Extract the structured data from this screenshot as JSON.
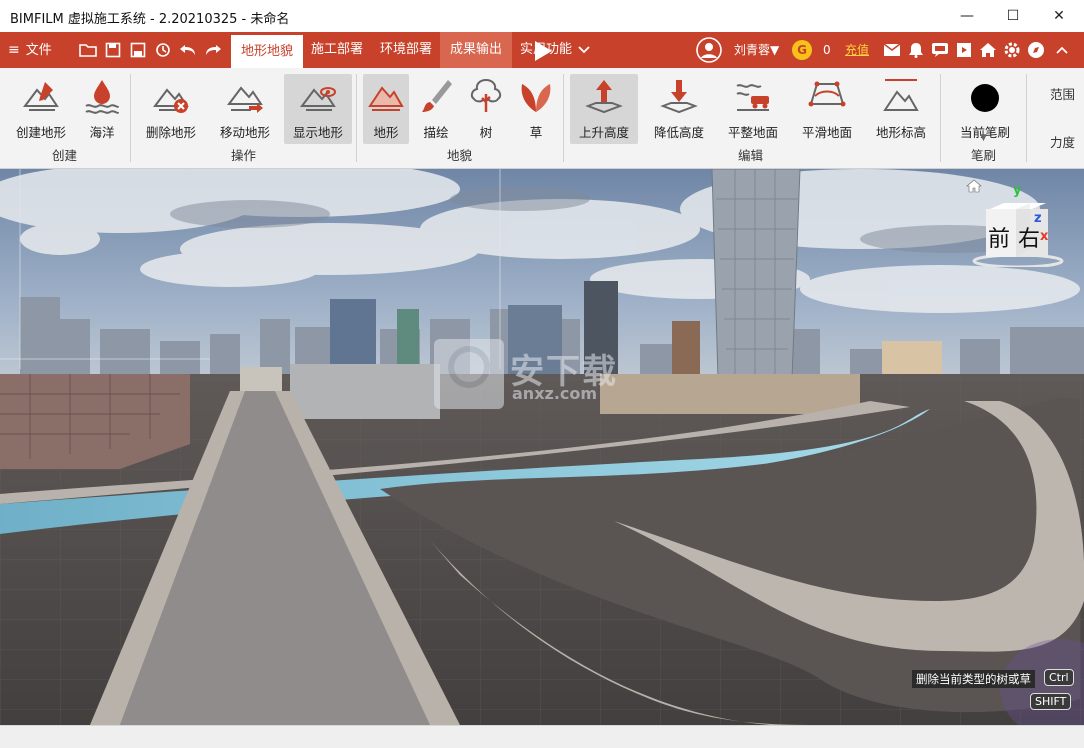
{
  "window": {
    "title": "BIMFILM 虚拟施工系统 - 2.20210325 - 未命名",
    "minimize": "—",
    "maximize": "☐",
    "close": "✕"
  },
  "menubar": {
    "file_label": "文件",
    "tabs": [
      {
        "label": "地形地貌",
        "active": true
      },
      {
        "label": "施工部署",
        "active": false
      },
      {
        "label": "环境部署",
        "active": false
      },
      {
        "label": "成果输出",
        "active": false
      },
      {
        "label": "实用功能",
        "active": false
      }
    ],
    "user": "刘青蓉▼",
    "coin_symbol": "G",
    "coin_value": "0",
    "recharge": "充值",
    "quick_icons": [
      "folder-open-icon",
      "save-icon",
      "save-as-icon",
      "history-icon",
      "undo-icon",
      "redo-icon"
    ],
    "right_icons": [
      "mail-icon",
      "bell-icon",
      "message-icon",
      "video-icon",
      "home-icon",
      "gear-icon",
      "compass-icon",
      "collapse-icon"
    ],
    "brand_color": "#c8412a"
  },
  "ribbon": {
    "groups": [
      {
        "label": "创建",
        "buttons": [
          "创建地形",
          "海洋"
        ]
      },
      {
        "label": "操作",
        "buttons": [
          "删除地形",
          "移动地形",
          "显示地形"
        ]
      },
      {
        "label": "地貌",
        "buttons": [
          "地形",
          "描绘",
          "树",
          "草"
        ]
      },
      {
        "label": "编辑",
        "buttons": [
          "上升高度",
          "降低高度",
          "平整地面",
          "平滑地面",
          "地形标高"
        ]
      },
      {
        "label": "笔刷",
        "buttons": [
          "当前笔刷"
        ]
      }
    ],
    "extra": [
      "范围",
      "力度"
    ],
    "selected": [
      "显示地形",
      "地形",
      "上升高度"
    ]
  },
  "viewport": {
    "axis_y": "y",
    "axis_x": "x",
    "axis_z": "z",
    "cube_front": "前",
    "cube_right": "右",
    "hint_text": "删除当前类型的树或草",
    "key_ctrl": "Ctrl",
    "key_shift": "SHIFT",
    "watermark": "安下载",
    "watermark_sub": "anxz.com"
  }
}
